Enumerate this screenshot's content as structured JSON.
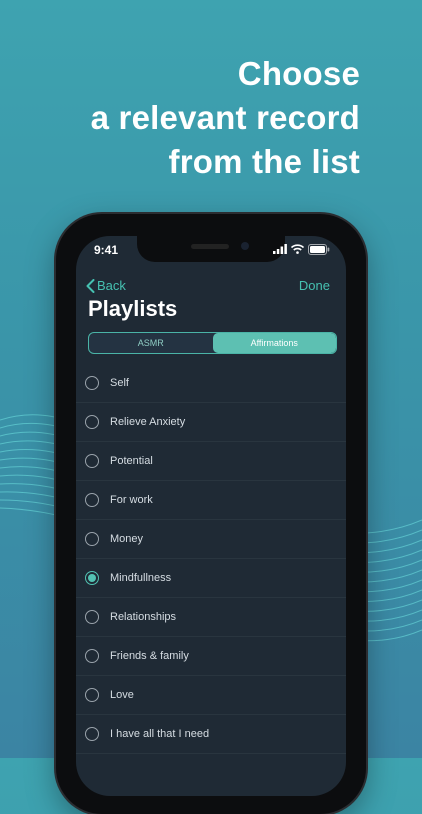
{
  "headline": {
    "line1": "Choose",
    "line2": "a relevant record",
    "line3": "from the list"
  },
  "status": {
    "time": "9:41"
  },
  "nav": {
    "back_label": "Back",
    "done_label": "Done"
  },
  "title": "Playlists",
  "segments": [
    {
      "label": "ASMR",
      "active": false
    },
    {
      "label": "Affirmations",
      "active": true
    }
  ],
  "items": [
    {
      "label": "Self",
      "selected": false
    },
    {
      "label": "Relieve Anxiety",
      "selected": false
    },
    {
      "label": "Potential",
      "selected": false
    },
    {
      "label": "For work",
      "selected": false
    },
    {
      "label": "Money",
      "selected": false
    },
    {
      "label": "Mindfullness",
      "selected": true
    },
    {
      "label": "Relationships",
      "selected": false
    },
    {
      "label": "Friends & family",
      "selected": false
    },
    {
      "label": "Love",
      "selected": false
    },
    {
      "label": "I have all that I need",
      "selected": false
    }
  ],
  "colors": {
    "accent": "#46c1b1",
    "background": "#3b94a9",
    "screen": "#1f2a35"
  }
}
